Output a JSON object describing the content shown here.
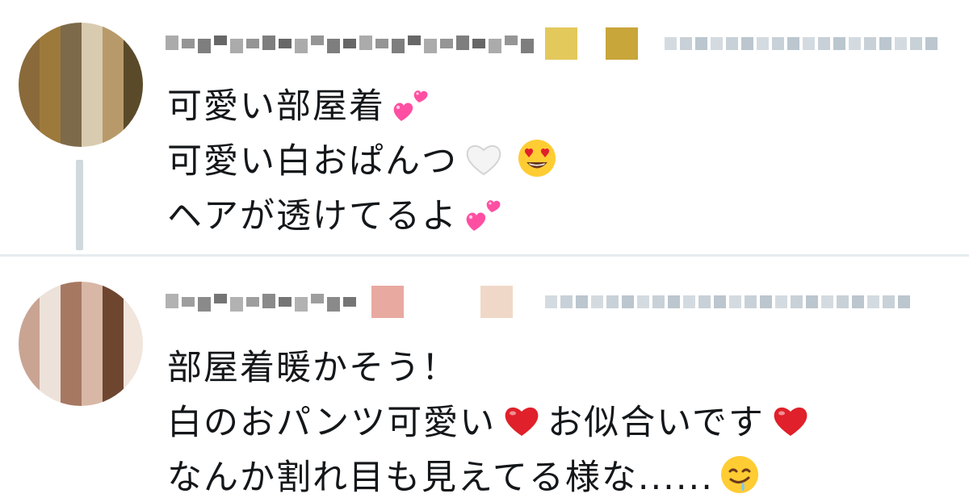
{
  "tweets": [
    {
      "author": {
        "display_name_redacted": true,
        "handle_redacted": true
      },
      "lines": [
        {
          "text": "可愛い部屋着",
          "emojis": [
            "two-hearts"
          ]
        },
        {
          "text": "可愛い白おぱんつ",
          "emojis": [
            "white-heart",
            "heart-eyes"
          ]
        },
        {
          "text": "ヘアが透けてるよ",
          "emojis": [
            "two-hearts"
          ]
        }
      ],
      "has_thread_line": true
    },
    {
      "author": {
        "display_name_redacted": true,
        "handle_redacted": true
      },
      "lines": [
        {
          "text": "部屋着暖かそう！",
          "emojis": []
        },
        {
          "text": "白のおパンツ可愛い",
          "emojis": [
            "red-heart"
          ],
          "text_after": "お似合いです",
          "emojis_after": [
            "red-heart"
          ]
        },
        {
          "text": "なんか割れ目も見えてる様な......",
          "emojis": [
            "drooling-face"
          ]
        }
      ],
      "has_thread_line": false
    }
  ],
  "colors": {
    "text": "#14171a",
    "divider": "#e6ecf0",
    "thread_line": "#cfd9de",
    "mosaic_name": "#444444",
    "mosaic_handle": "#aab8c2",
    "heart_pink": "#ff4fa3",
    "heart_red": "#e0202a"
  }
}
